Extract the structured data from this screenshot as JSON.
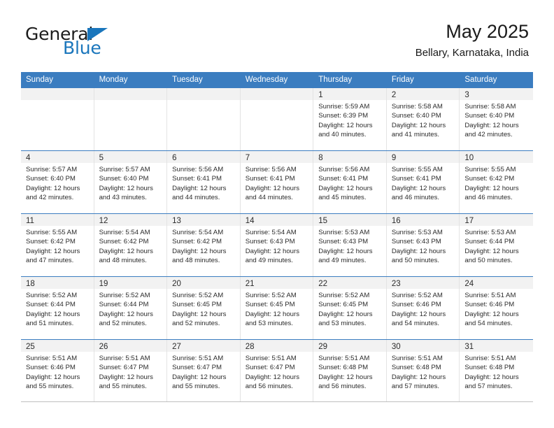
{
  "brand": {
    "word1": "General",
    "word2": "Blue",
    "accent_color": "#1a76bc"
  },
  "header": {
    "title": "May 2025",
    "subtitle": "Bellary, Karnataka, India"
  },
  "calendar": {
    "header_bg": "#3b7dc0",
    "daynum_band_bg": "#f2f2f2",
    "weekday_headers": [
      "Sunday",
      "Monday",
      "Tuesday",
      "Wednesday",
      "Thursday",
      "Friday",
      "Saturday"
    ],
    "weeks": [
      [
        {
          "day": "",
          "sunrise": "",
          "sunset": "",
          "daylight1": "",
          "daylight2": ""
        },
        {
          "day": "",
          "sunrise": "",
          "sunset": "",
          "daylight1": "",
          "daylight2": ""
        },
        {
          "day": "",
          "sunrise": "",
          "sunset": "",
          "daylight1": "",
          "daylight2": ""
        },
        {
          "day": "",
          "sunrise": "",
          "sunset": "",
          "daylight1": "",
          "daylight2": ""
        },
        {
          "day": "1",
          "sunrise": "Sunrise: 5:59 AM",
          "sunset": "Sunset: 6:39 PM",
          "daylight1": "Daylight: 12 hours",
          "daylight2": "and 40 minutes."
        },
        {
          "day": "2",
          "sunrise": "Sunrise: 5:58 AM",
          "sunset": "Sunset: 6:40 PM",
          "daylight1": "Daylight: 12 hours",
          "daylight2": "and 41 minutes."
        },
        {
          "day": "3",
          "sunrise": "Sunrise: 5:58 AM",
          "sunset": "Sunset: 6:40 PM",
          "daylight1": "Daylight: 12 hours",
          "daylight2": "and 42 minutes."
        }
      ],
      [
        {
          "day": "4",
          "sunrise": "Sunrise: 5:57 AM",
          "sunset": "Sunset: 6:40 PM",
          "daylight1": "Daylight: 12 hours",
          "daylight2": "and 42 minutes."
        },
        {
          "day": "5",
          "sunrise": "Sunrise: 5:57 AM",
          "sunset": "Sunset: 6:40 PM",
          "daylight1": "Daylight: 12 hours",
          "daylight2": "and 43 minutes."
        },
        {
          "day": "6",
          "sunrise": "Sunrise: 5:56 AM",
          "sunset": "Sunset: 6:41 PM",
          "daylight1": "Daylight: 12 hours",
          "daylight2": "and 44 minutes."
        },
        {
          "day": "7",
          "sunrise": "Sunrise: 5:56 AM",
          "sunset": "Sunset: 6:41 PM",
          "daylight1": "Daylight: 12 hours",
          "daylight2": "and 44 minutes."
        },
        {
          "day": "8",
          "sunrise": "Sunrise: 5:56 AM",
          "sunset": "Sunset: 6:41 PM",
          "daylight1": "Daylight: 12 hours",
          "daylight2": "and 45 minutes."
        },
        {
          "day": "9",
          "sunrise": "Sunrise: 5:55 AM",
          "sunset": "Sunset: 6:41 PM",
          "daylight1": "Daylight: 12 hours",
          "daylight2": "and 46 minutes."
        },
        {
          "day": "10",
          "sunrise": "Sunrise: 5:55 AM",
          "sunset": "Sunset: 6:42 PM",
          "daylight1": "Daylight: 12 hours",
          "daylight2": "and 46 minutes."
        }
      ],
      [
        {
          "day": "11",
          "sunrise": "Sunrise: 5:55 AM",
          "sunset": "Sunset: 6:42 PM",
          "daylight1": "Daylight: 12 hours",
          "daylight2": "and 47 minutes."
        },
        {
          "day": "12",
          "sunrise": "Sunrise: 5:54 AM",
          "sunset": "Sunset: 6:42 PM",
          "daylight1": "Daylight: 12 hours",
          "daylight2": "and 48 minutes."
        },
        {
          "day": "13",
          "sunrise": "Sunrise: 5:54 AM",
          "sunset": "Sunset: 6:42 PM",
          "daylight1": "Daylight: 12 hours",
          "daylight2": "and 48 minutes."
        },
        {
          "day": "14",
          "sunrise": "Sunrise: 5:54 AM",
          "sunset": "Sunset: 6:43 PM",
          "daylight1": "Daylight: 12 hours",
          "daylight2": "and 49 minutes."
        },
        {
          "day": "15",
          "sunrise": "Sunrise: 5:53 AM",
          "sunset": "Sunset: 6:43 PM",
          "daylight1": "Daylight: 12 hours",
          "daylight2": "and 49 minutes."
        },
        {
          "day": "16",
          "sunrise": "Sunrise: 5:53 AM",
          "sunset": "Sunset: 6:43 PM",
          "daylight1": "Daylight: 12 hours",
          "daylight2": "and 50 minutes."
        },
        {
          "day": "17",
          "sunrise": "Sunrise: 5:53 AM",
          "sunset": "Sunset: 6:44 PM",
          "daylight1": "Daylight: 12 hours",
          "daylight2": "and 50 minutes."
        }
      ],
      [
        {
          "day": "18",
          "sunrise": "Sunrise: 5:52 AM",
          "sunset": "Sunset: 6:44 PM",
          "daylight1": "Daylight: 12 hours",
          "daylight2": "and 51 minutes."
        },
        {
          "day": "19",
          "sunrise": "Sunrise: 5:52 AM",
          "sunset": "Sunset: 6:44 PM",
          "daylight1": "Daylight: 12 hours",
          "daylight2": "and 52 minutes."
        },
        {
          "day": "20",
          "sunrise": "Sunrise: 5:52 AM",
          "sunset": "Sunset: 6:45 PM",
          "daylight1": "Daylight: 12 hours",
          "daylight2": "and 52 minutes."
        },
        {
          "day": "21",
          "sunrise": "Sunrise: 5:52 AM",
          "sunset": "Sunset: 6:45 PM",
          "daylight1": "Daylight: 12 hours",
          "daylight2": "and 53 minutes."
        },
        {
          "day": "22",
          "sunrise": "Sunrise: 5:52 AM",
          "sunset": "Sunset: 6:45 PM",
          "daylight1": "Daylight: 12 hours",
          "daylight2": "and 53 minutes."
        },
        {
          "day": "23",
          "sunrise": "Sunrise: 5:52 AM",
          "sunset": "Sunset: 6:46 PM",
          "daylight1": "Daylight: 12 hours",
          "daylight2": "and 54 minutes."
        },
        {
          "day": "24",
          "sunrise": "Sunrise: 5:51 AM",
          "sunset": "Sunset: 6:46 PM",
          "daylight1": "Daylight: 12 hours",
          "daylight2": "and 54 minutes."
        }
      ],
      [
        {
          "day": "25",
          "sunrise": "Sunrise: 5:51 AM",
          "sunset": "Sunset: 6:46 PM",
          "daylight1": "Daylight: 12 hours",
          "daylight2": "and 55 minutes."
        },
        {
          "day": "26",
          "sunrise": "Sunrise: 5:51 AM",
          "sunset": "Sunset: 6:47 PM",
          "daylight1": "Daylight: 12 hours",
          "daylight2": "and 55 minutes."
        },
        {
          "day": "27",
          "sunrise": "Sunrise: 5:51 AM",
          "sunset": "Sunset: 6:47 PM",
          "daylight1": "Daylight: 12 hours",
          "daylight2": "and 55 minutes."
        },
        {
          "day": "28",
          "sunrise": "Sunrise: 5:51 AM",
          "sunset": "Sunset: 6:47 PM",
          "daylight1": "Daylight: 12 hours",
          "daylight2": "and 56 minutes."
        },
        {
          "day": "29",
          "sunrise": "Sunrise: 5:51 AM",
          "sunset": "Sunset: 6:48 PM",
          "daylight1": "Daylight: 12 hours",
          "daylight2": "and 56 minutes."
        },
        {
          "day": "30",
          "sunrise": "Sunrise: 5:51 AM",
          "sunset": "Sunset: 6:48 PM",
          "daylight1": "Daylight: 12 hours",
          "daylight2": "and 57 minutes."
        },
        {
          "day": "31",
          "sunrise": "Sunrise: 5:51 AM",
          "sunset": "Sunset: 6:48 PM",
          "daylight1": "Daylight: 12 hours",
          "daylight2": "and 57 minutes."
        }
      ]
    ]
  }
}
